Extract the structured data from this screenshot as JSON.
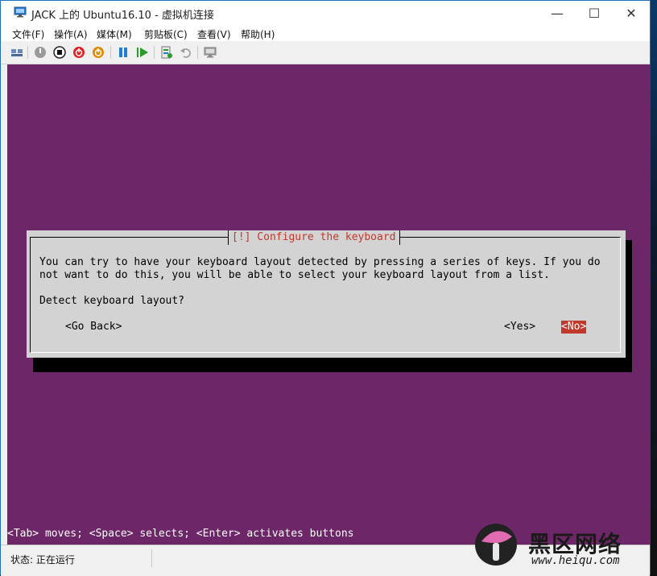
{
  "window": {
    "title": "JACK 上的 Ubuntu16.10 - 虚拟机连接",
    "controls": {
      "minimize": "—",
      "maximize": "☐",
      "close": "✕"
    }
  },
  "menu": [
    "文件(F)",
    "操作(A)",
    "媒体(M)",
    "剪贴板(C)",
    "查看(V)",
    "帮助(H)"
  ],
  "toolbar": {
    "icons": [
      "ctrl-alt-del-icon",
      "start-icon",
      "turn-off-icon",
      "shutdown-icon",
      "power-icon",
      "pause-icon",
      "reset-icon",
      "checkpoint-icon",
      "revert-icon",
      "enhanced-session-icon"
    ]
  },
  "installer": {
    "dialog_title": "[!] Configure the keyboard",
    "body_line1": "You can try to have your keyboard layout detected by pressing a series of keys. If you do",
    "body_line2": "not want to do this, you will be able to select your keyboard layout from a list.",
    "question": "Detect keyboard layout?",
    "go_back": "<Go Back>",
    "yes": "<Yes>",
    "no": "<No>",
    "help_line": "<Tab> moves; <Space> selects; <Enter> activates buttons"
  },
  "status": {
    "text": "状态: 正在运行"
  },
  "watermark": {
    "main": "黑区网络",
    "sub": "www.heiqu.com"
  },
  "colors": {
    "screen_bg": "#6d2667",
    "dialog_bg": "#d3d3d3",
    "accent_red": "#c0392b"
  }
}
